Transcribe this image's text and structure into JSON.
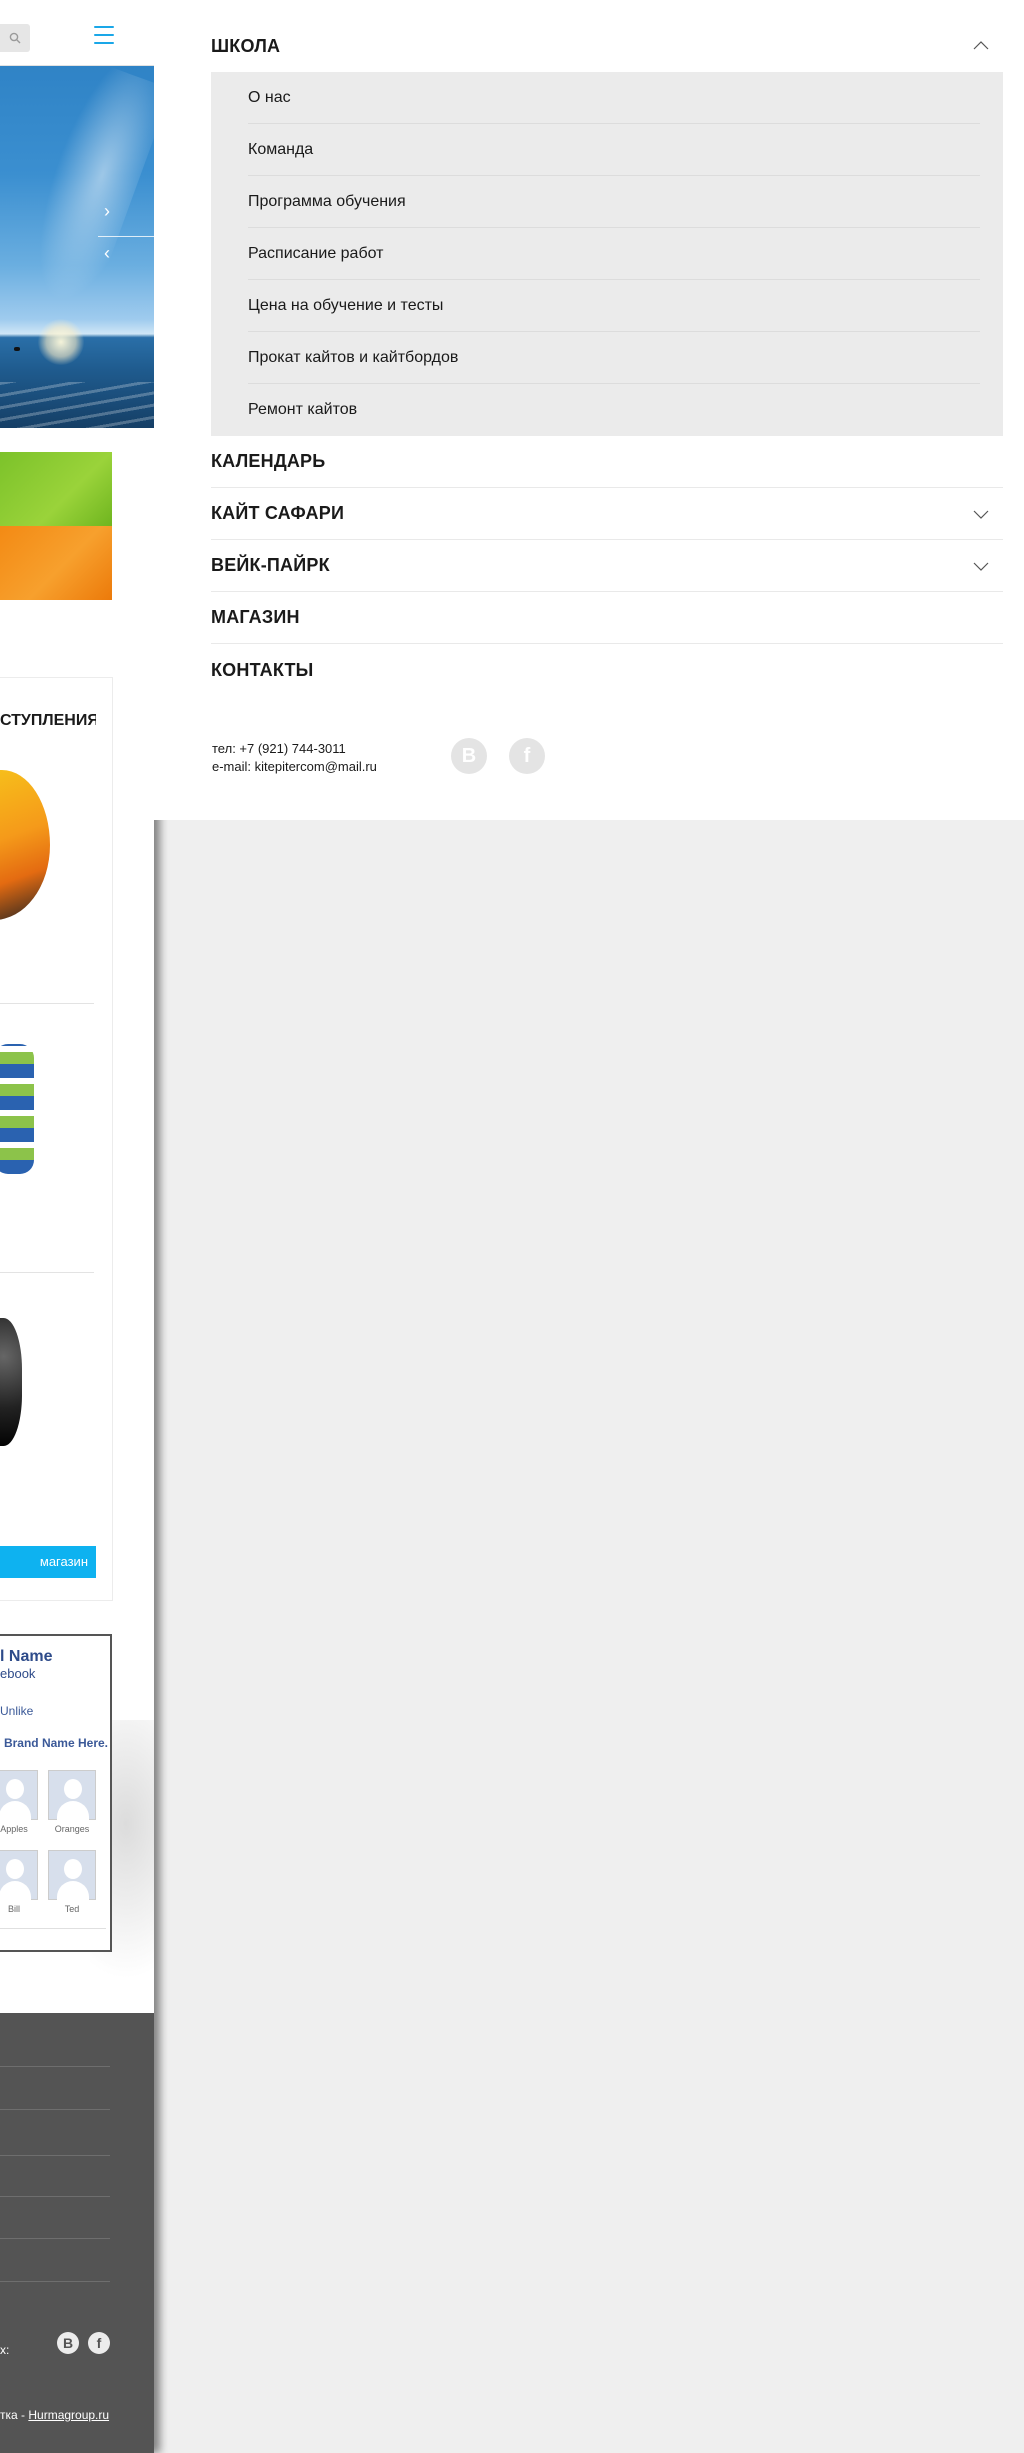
{
  "menu": {
    "items": [
      {
        "label": "ШКОЛА",
        "expanded": true,
        "sub": [
          "О нас",
          "Команда",
          "Программа обучения",
          "Расписание работ",
          "Цена на обучение и тесты",
          "Прокат кайтов и кайтбордов",
          "Ремонт кайтов"
        ]
      },
      {
        "label": "КАЛЕНДАРЬ"
      },
      {
        "label": "КАЙТ САФАРИ",
        "expandable": true
      },
      {
        "label": "ВЕЙК-ПАЙРК",
        "expandable": true
      },
      {
        "label": "МАГАЗИН"
      },
      {
        "label": "КОНТАКТЫ"
      }
    ],
    "contacts": {
      "phone": "тел: +7 (921) 744-3011",
      "email": "e-mail: kitepitercom@mail.ru"
    },
    "social": [
      {
        "icon": "vk-icon",
        "glyph": "B"
      },
      {
        "icon": "facebook-icon",
        "glyph": "f"
      }
    ]
  },
  "background_page": {
    "products_title": "СТУПЛЕНИЯ",
    "shop_button": "магазин",
    "facebook_widget": {
      "name": "l Name",
      "subtitle": "ebook",
      "unlike": "Unlike",
      "brand": "Brand Name Here.",
      "friends": [
        "Apples",
        "Oranges",
        "Bill",
        "Ted"
      ]
    },
    "footer": {
      "follow_label": "х:",
      "social": [
        "B",
        "f"
      ],
      "credit_prefix": "тка - ",
      "credit_link": "Hurmagroup.ru"
    }
  },
  "colors": {
    "accent": "#1aa7e8",
    "shop_button": "#0eb2f0",
    "footer_bg": "#545454",
    "submenu_bg": "#ebebeb"
  }
}
